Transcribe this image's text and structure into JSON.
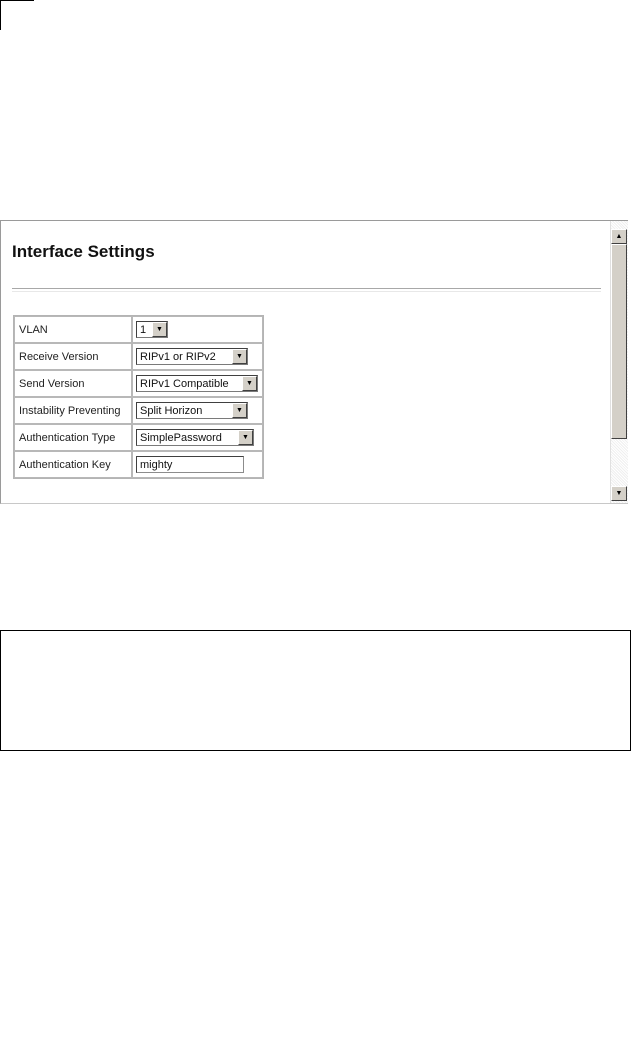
{
  "page": {
    "title": "Interface Settings"
  },
  "rows": [
    {
      "label": "VLAN",
      "control": "select",
      "value": "1"
    },
    {
      "label": "Receive Version",
      "control": "select",
      "value": "RIPv1 or RIPv2"
    },
    {
      "label": "Send Version",
      "control": "select",
      "value": "RIPv1 Compatible"
    },
    {
      "label": "Instability Preventing",
      "control": "select",
      "value": "Split Horizon"
    },
    {
      "label": "Authentication Type",
      "control": "select",
      "value": "SimplePassword"
    },
    {
      "label": "Authentication Key",
      "control": "text",
      "value": "mighty"
    }
  ],
  "icons": {
    "dropdown": "chevron-down-icon",
    "scroll_up": "arrow-up-icon",
    "scroll_down": "arrow-down-icon"
  }
}
